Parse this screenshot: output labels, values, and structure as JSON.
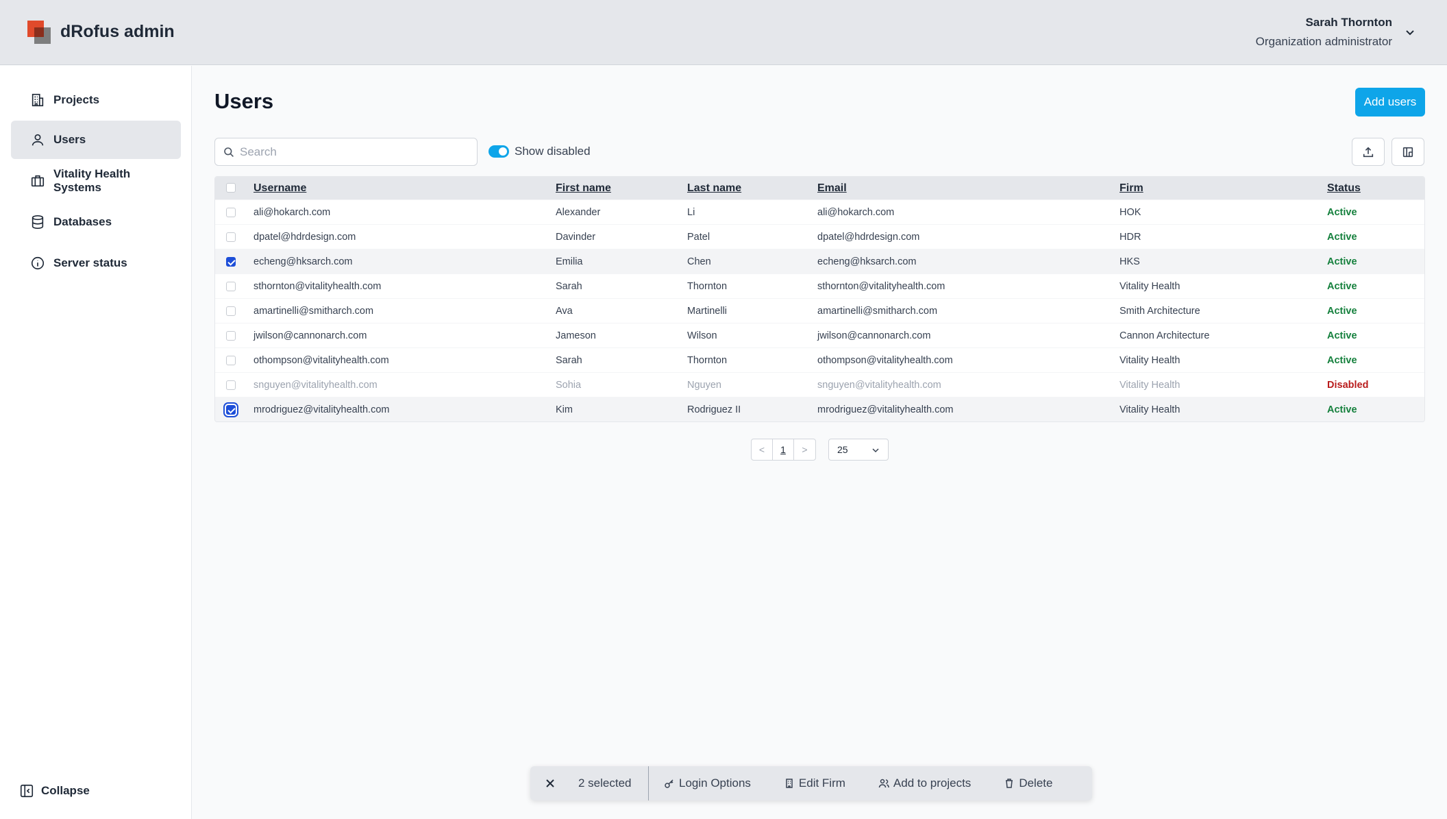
{
  "app": {
    "title": "dRofus admin"
  },
  "user": {
    "name": "Sarah Thornton",
    "role": "Organization administrator"
  },
  "sidebar": {
    "items": [
      {
        "label": "Projects",
        "icon": "building-icon"
      },
      {
        "label": "Users",
        "icon": "user-icon",
        "active": true
      },
      {
        "label": "Vitality Health Systems",
        "icon": "briefcase-icon"
      },
      {
        "label": "Databases",
        "icon": "database-icon"
      },
      {
        "label": "Server status",
        "icon": "info-icon"
      }
    ],
    "collapse_label": "Collapse"
  },
  "main": {
    "title": "Users",
    "add_button": "Add users",
    "search": {
      "placeholder": "Search",
      "value": ""
    },
    "show_disabled": {
      "label": "Show disabled",
      "on": true
    }
  },
  "table": {
    "columns": [
      "Username",
      "First name",
      "Last name",
      "Email",
      "Firm",
      "Status"
    ],
    "rows": [
      {
        "username": "ali@hokarch.com",
        "first": "Alexander",
        "last": "Li",
        "email": "ali@hokarch.com",
        "firm": "HOK",
        "status": "Active",
        "checked": false
      },
      {
        "username": "dpatel@hdrdesign.com",
        "first": "Davinder",
        "last": "Patel",
        "email": "dpatel@hdrdesign.com",
        "firm": "HDR",
        "status": "Active",
        "checked": false
      },
      {
        "username": "echeng@hksarch.com",
        "first": "Emilia",
        "last": "Chen",
        "email": "echeng@hksarch.com",
        "firm": "HKS",
        "status": "Active",
        "checked": true
      },
      {
        "username": "sthornton@vitalityhealth.com",
        "first": "Sarah",
        "last": "Thornton",
        "email": "sthornton@vitalityhealth.com",
        "firm": "Vitality Health",
        "status": "Active",
        "checked": false
      },
      {
        "username": "amartinelli@smitharch.com",
        "first": "Ava",
        "last": "Martinelli",
        "email": "amartinelli@smitharch.com",
        "firm": "Smith Architecture",
        "status": "Active",
        "checked": false
      },
      {
        "username": "jwilson@cannonarch.com",
        "first": "Jameson",
        "last": "Wilson",
        "email": "jwilson@cannonarch.com",
        "firm": "Cannon Architecture",
        "status": "Active",
        "checked": false
      },
      {
        "username": "othompson@vitalityhealth.com",
        "first": "Sarah",
        "last": "Thornton",
        "email": "othompson@vitalityhealth.com",
        "firm": "Vitality Health",
        "status": "Active",
        "checked": false
      },
      {
        "username": "snguyen@vitalityhealth.com",
        "first": "Sohia",
        "last": "Nguyen",
        "email": "snguyen@vitalityhealth.com",
        "firm": "Vitality Health",
        "status": "Disabled",
        "checked": false
      },
      {
        "username": "mrodriguez@vitalityhealth.com",
        "first": "Kim",
        "last": "Rodriguez II",
        "email": "mrodriguez@vitalityhealth.com",
        "firm": "Vitality Health",
        "status": "Active",
        "checked": true
      }
    ]
  },
  "pagination": {
    "prev": "<",
    "page": "1",
    "next": ">",
    "page_size": "25"
  },
  "bulk": {
    "count": "2 selected",
    "actions": [
      {
        "label": "Login Options",
        "icon": "key-icon"
      },
      {
        "label": "Edit Firm",
        "icon": "building-icon"
      },
      {
        "label": "Add to projects",
        "icon": "users-icon"
      },
      {
        "label": "Delete",
        "icon": "trash-icon"
      }
    ]
  },
  "colors": {
    "accent": "#0ea5e9",
    "active": "#15803d",
    "disabled": "#b91c1c",
    "checkbox": "#1d4ed8"
  }
}
